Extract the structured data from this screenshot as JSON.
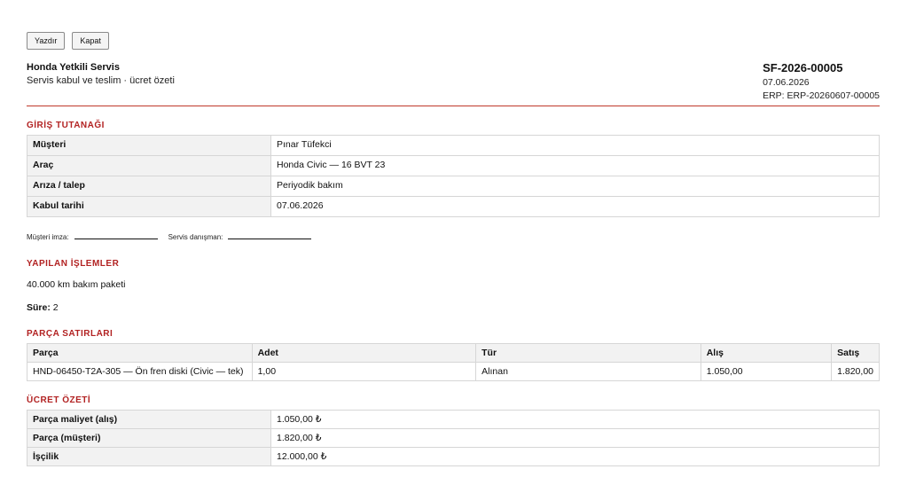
{
  "actions": {
    "print_label": "Yazdır",
    "close_label": "Kapat"
  },
  "header": {
    "company": "Honda Yetkili Servis",
    "subtitle": "Servis kabul ve teslim · ücret özeti",
    "doc_no": "SF-2026-00005",
    "date": "07.06.2026",
    "erp": "ERP: ERP-20260607-00005"
  },
  "intake": {
    "title": "GİRİŞ TUTANAĞI",
    "rows": [
      {
        "label": "Müşteri",
        "value": "Pınar Tüfekci"
      },
      {
        "label": "Araç",
        "value": "Honda Civic — 16 BVT 23"
      },
      {
        "label": "Arıza / talep",
        "value": "Periyodik bakım"
      },
      {
        "label": "Kabul tarihi",
        "value": "07.06.2026"
      }
    ]
  },
  "signatures": {
    "customer_label": "Müşteri imza:",
    "advisor_label": "Servis danışman:"
  },
  "work": {
    "title": "YAPILAN İŞLEMLER",
    "description": "40.000 km bakım paketi",
    "duration_label": "Süre:",
    "duration_value": "2"
  },
  "parts": {
    "title": "PARÇA SATIRLARI",
    "columns": [
      "Parça",
      "Adet",
      "Tür",
      "Alış",
      "Satış"
    ],
    "rows": [
      [
        "HND-06450-T2A-305 — Ön fren diski (Civic — tek)",
        "1,00",
        "Alınan",
        "1.050,00",
        "1.820,00"
      ]
    ]
  },
  "summary": {
    "title": "ÜCRET ÖZETİ",
    "rows": [
      {
        "label": "Parça maliyet (alış)",
        "value": "1.050,00 ₺"
      },
      {
        "label": "Parça (müşteri)",
        "value": "1.820,00 ₺"
      },
      {
        "label": "İşçilik",
        "value": "12.000,00 ₺"
      }
    ]
  }
}
